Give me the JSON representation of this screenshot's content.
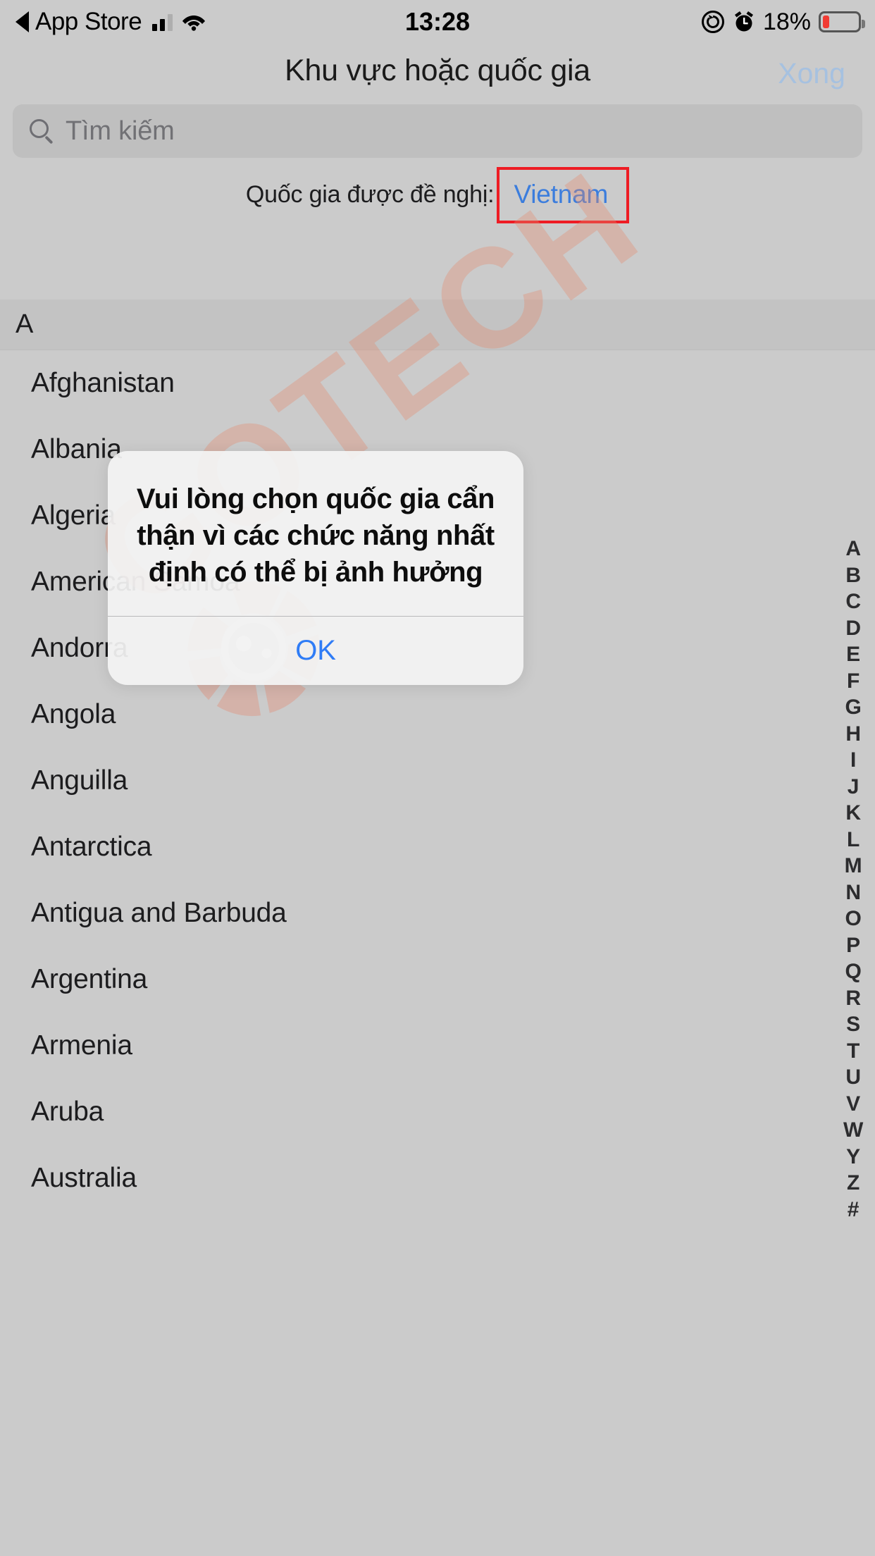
{
  "status_bar": {
    "back_app": "App Store",
    "time": "13:28",
    "battery_percent": "18%",
    "battery_level": 18,
    "icons": {
      "back_arrow": "back-triangle-icon",
      "signal": "cellular-signal-icon",
      "wifi": "wifi-icon",
      "rotation_lock": "rotation-lock-icon",
      "alarm": "alarm-clock-icon",
      "battery": "battery-icon"
    }
  },
  "nav": {
    "title": "Khu vực hoặc quốc gia",
    "done_label": "Xong"
  },
  "search": {
    "placeholder": "Tìm kiếm",
    "value": "",
    "icon": "search-icon"
  },
  "suggested": {
    "label": "Quốc gia được đề nghị:",
    "value": "Vietnam",
    "highlight_color": "#ee1c24",
    "value_color": "#3b7ddd"
  },
  "section": {
    "header": "A"
  },
  "countries": [
    "Afghanistan",
    "Albania",
    "Algeria",
    "American Samoa",
    "Andorra",
    "Angola",
    "Anguilla",
    "Antarctica",
    "Antigua and Barbuda",
    "Argentina",
    "Armenia",
    "Aruba",
    "Australia"
  ],
  "index_strip": [
    "A",
    "B",
    "C",
    "D",
    "E",
    "F",
    "G",
    "H",
    "I",
    "J",
    "K",
    "L",
    "M",
    "N",
    "O",
    "P",
    "Q",
    "R",
    "S",
    "T",
    "U",
    "V",
    "W",
    "Y",
    "Z",
    "#"
  ],
  "alert": {
    "message": "Vui lòng chọn quốc gia cẩn thận vì các chức năng nhất định có thể bị ảnh hưởng",
    "ok_label": "OK",
    "ok_color": "#2f7cf6"
  },
  "watermark": {
    "text": "GOTECH",
    "color": "#e28a70"
  }
}
